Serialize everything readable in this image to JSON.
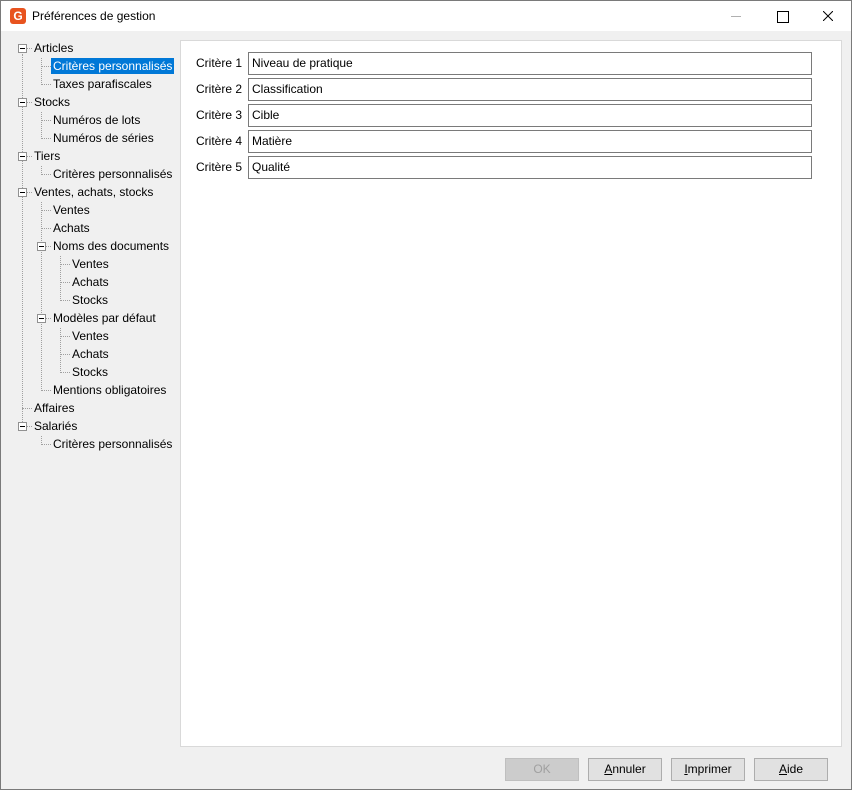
{
  "window": {
    "title": "Préférences de gestion",
    "app_icon_letter": "G"
  },
  "tree": {
    "articles": "Articles",
    "articles_criteres": "Critères personnalisés",
    "articles_taxes": "Taxes parafiscales",
    "stocks": "Stocks",
    "stocks_lots": "Numéros de lots",
    "stocks_series": "Numéros de séries",
    "tiers": "Tiers",
    "tiers_criteres": "Critères personnalisés",
    "vas": "Ventes, achats, stocks",
    "vas_ventes": "Ventes",
    "vas_achats": "Achats",
    "vas_noms": "Noms des documents",
    "noms_ventes": "Ventes",
    "noms_achats": "Achats",
    "noms_stocks": "Stocks",
    "vas_modeles": "Modèles par défaut",
    "modeles_ventes": "Ventes",
    "modeles_achats": "Achats",
    "modeles_stocks": "Stocks",
    "vas_mentions": "Mentions obligatoires",
    "affaires": "Affaires",
    "salaries": "Salariés",
    "salaries_criteres": "Critères personnalisés"
  },
  "criteria": [
    {
      "label": "Critère 1",
      "value": "Niveau de pratique"
    },
    {
      "label": "Critère 2",
      "value": "Classification"
    },
    {
      "label": "Critère 3",
      "value": "Cible"
    },
    {
      "label": "Critère 4",
      "value": "Matière"
    },
    {
      "label": "Critère 5",
      "value": "Qualité"
    }
  ],
  "buttons": {
    "ok": "OK",
    "annuler_first": "A",
    "annuler_rest": "nnuler",
    "imprimer_first": "I",
    "imprimer_rest": "mprimer",
    "aide_first": "A",
    "aide_rest": "ide"
  }
}
